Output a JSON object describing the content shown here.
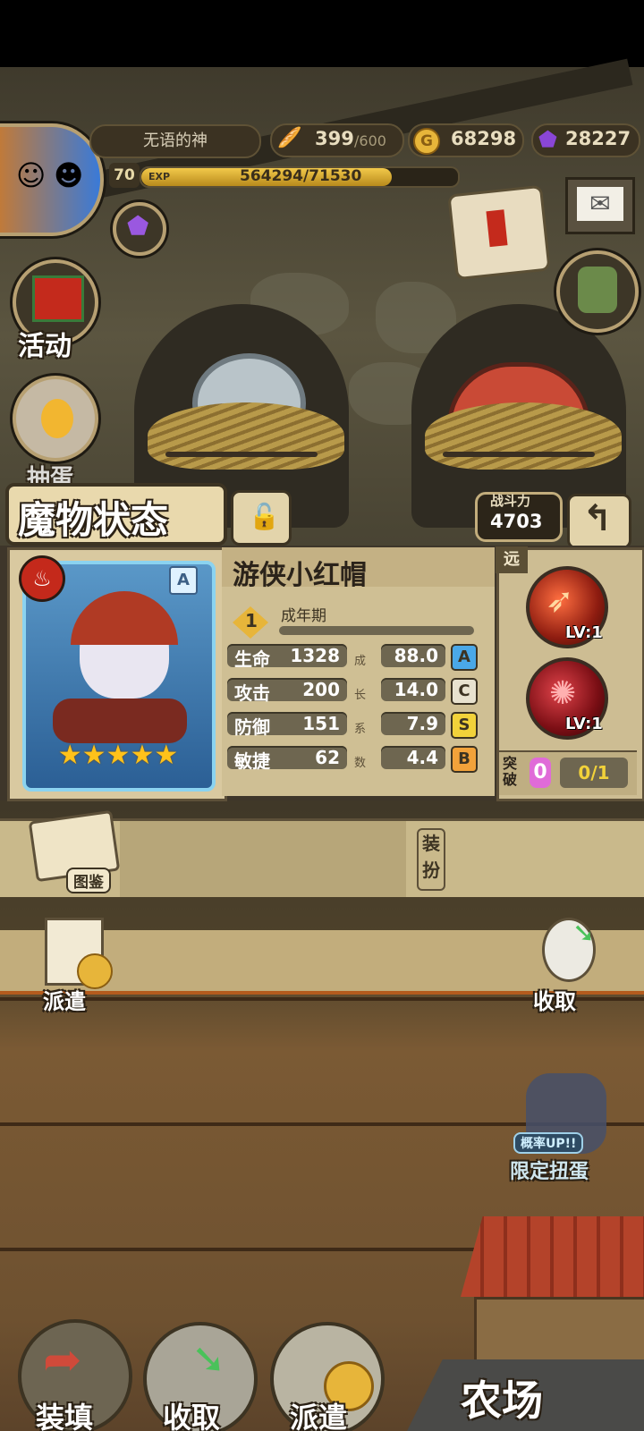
{
  "player": {
    "name": "无语的神",
    "level": "70",
    "exp_label": "EXP",
    "exp_text": "564294/71530",
    "exp_progress": 0.79
  },
  "resources": {
    "bread": "399",
    "bread_max": "/600",
    "gold": "68298",
    "gems": "28227"
  },
  "side_menu": {
    "activity_label": "活动",
    "gacha_label": "抽蛋"
  },
  "monster": {
    "panel_title": "魔物状态",
    "combat_power_label": "战斗力",
    "combat_power": "4703",
    "name": "游侠小红帽",
    "grade": "A",
    "stage_number": "1",
    "stage_label": "成年期",
    "stars": 5,
    "range_tag": "远",
    "growth_label_chars": [
      "成",
      "长",
      "系",
      "数"
    ],
    "stats": [
      {
        "label": "生命",
        "value": "1328",
        "growth": "88.0",
        "grade": "A",
        "grade_color": "#4aa8e8"
      },
      {
        "label": "攻击",
        "value": "200",
        "growth": "14.0",
        "grade": "C",
        "grade_color": "#e8e2cf"
      },
      {
        "label": "防御",
        "value": "151",
        "growth": "7.9",
        "grade": "S",
        "grade_color": "#f2d23a"
      },
      {
        "label": "敏捷",
        "value": "62",
        "growth": "4.4",
        "grade": "B",
        "grade_color": "#f2a23a"
      }
    ],
    "skills": [
      {
        "level": "LV:1"
      },
      {
        "level": "LV:1"
      }
    ],
    "breakthrough_label": "突破",
    "breakthrough_count": "0",
    "breakthrough_progress": "0/1",
    "dress_label": "装扮",
    "handbook_label": "图鉴"
  },
  "field": {
    "dispatch_label": "派遣",
    "collect_label": "收取",
    "limited_banner_top": "概率UP!!",
    "limited_banner_bottom": "限定扭蛋"
  },
  "bottom_nav": {
    "load_label": "装填",
    "collect_label": "收取",
    "dispatch_label": "派遣",
    "farm_label": "农场"
  },
  "colors": {
    "accent_gold": "#e7b53a",
    "gem_purple": "#7a3fbf",
    "fire_red": "#c4291b"
  }
}
